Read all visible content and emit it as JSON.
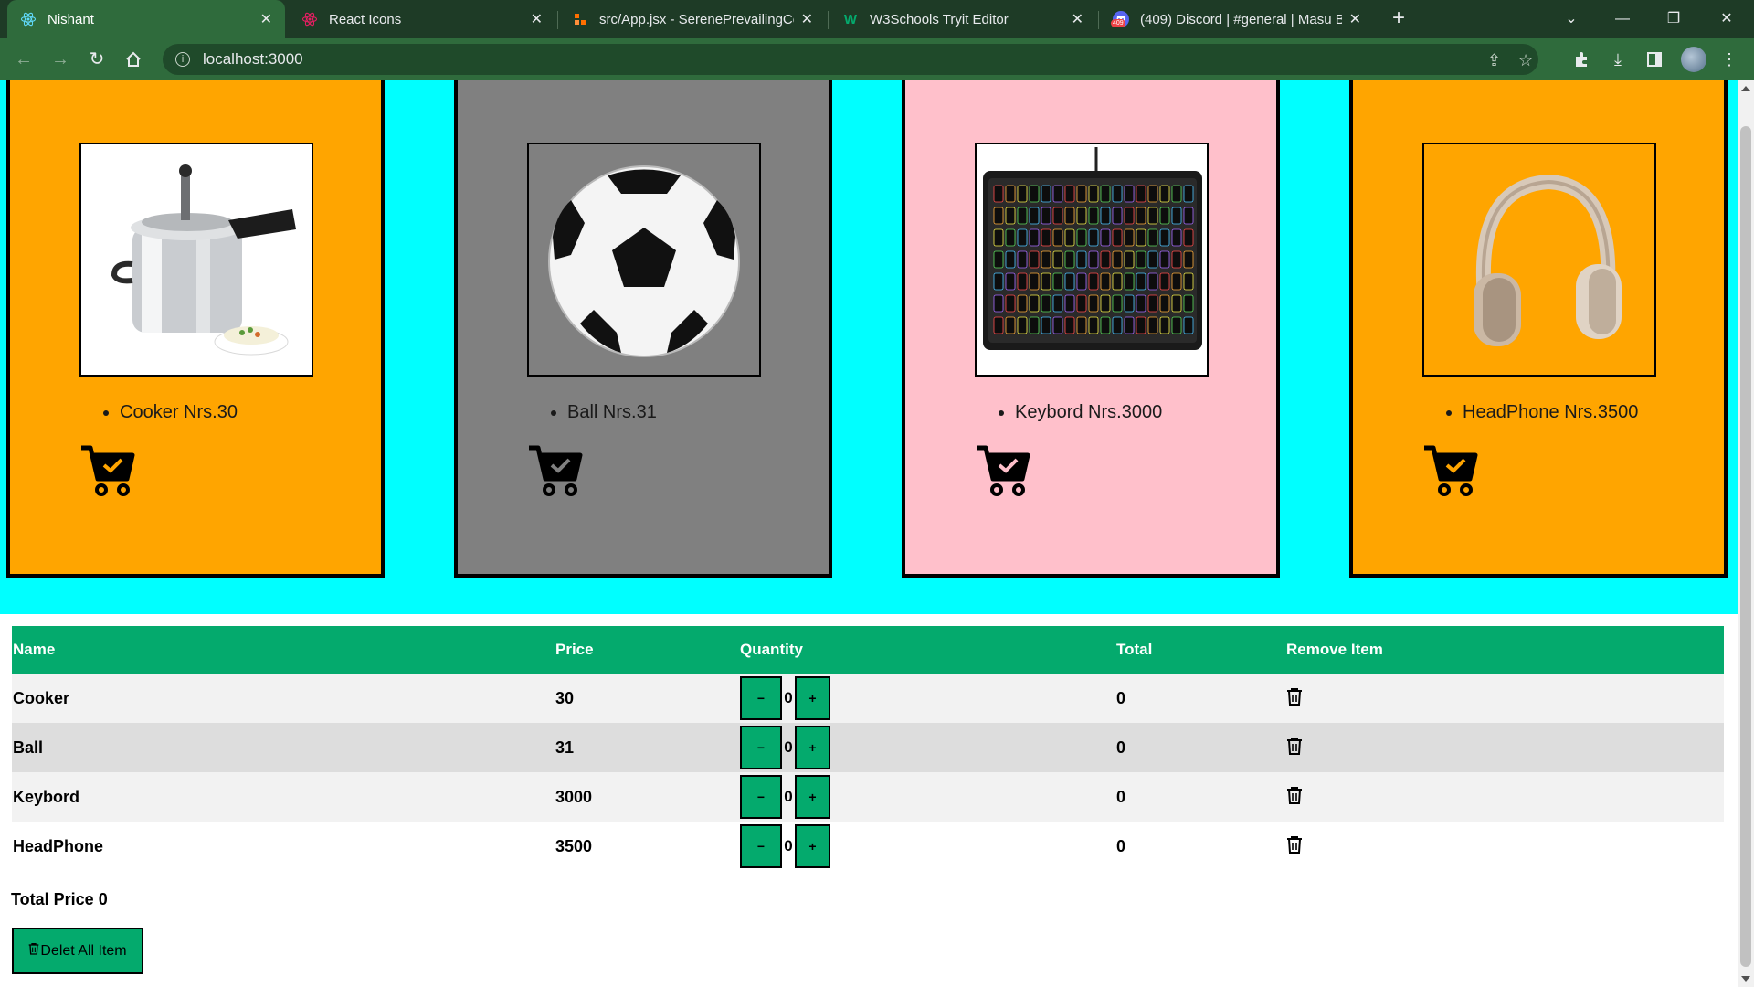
{
  "browser": {
    "tabs": [
      {
        "title": "Nishant",
        "icon": "react-icon",
        "active": true
      },
      {
        "title": "React Icons",
        "icon": "react-icon",
        "active": false
      },
      {
        "title": "src/App.jsx - SerenePrevailingCer",
        "icon": "codesandbox-icon",
        "active": false
      },
      {
        "title": "W3Schools Tryit Editor",
        "icon": "w3schools-icon",
        "active": false
      },
      {
        "title": "(409) Discord | #general | Masu B",
        "icon": "discord-icon",
        "badge": "409",
        "active": false
      }
    ],
    "url": "localhost:3000"
  },
  "products": [
    {
      "name": "Cooker",
      "label": "Cooker Nrs.30",
      "background": "#ffa500",
      "image": "pressure-cooker"
    },
    {
      "name": "Ball",
      "label": "Ball Nrs.31",
      "background": "#808080",
      "image": "soccer-ball"
    },
    {
      "name": "Keybord",
      "label": "Keybord Nrs.3000",
      "background": "#ffc0cb",
      "image": "keyboard"
    },
    {
      "name": "HeadPhone",
      "label": "HeadPhone Nrs.3500",
      "background": "#ffa500",
      "image": "headphones"
    }
  ],
  "table": {
    "headers": [
      "Name",
      "Price",
      "Quantity",
      "Total",
      "Remove Item"
    ],
    "rows": [
      {
        "name": "Cooker",
        "price": "30",
        "quantity": "0",
        "total": "0"
      },
      {
        "name": "Ball",
        "price": "31",
        "quantity": "0",
        "total": "0"
      },
      {
        "name": "Keybord",
        "price": "3000",
        "quantity": "0",
        "total": "0"
      },
      {
        "name": "HeadPhone",
        "price": "3500",
        "quantity": "0",
        "total": "0"
      }
    ],
    "minus_label": "−",
    "plus_label": "+"
  },
  "summary": {
    "total_label": "Total Price 0",
    "delete_all_label": "Delet All Item"
  },
  "colors": {
    "page_bg": "#00ffff",
    "table_header": "#04aa6d",
    "chrome_dark": "#1e3b26",
    "chrome_toolbar": "#2f6b3c"
  }
}
